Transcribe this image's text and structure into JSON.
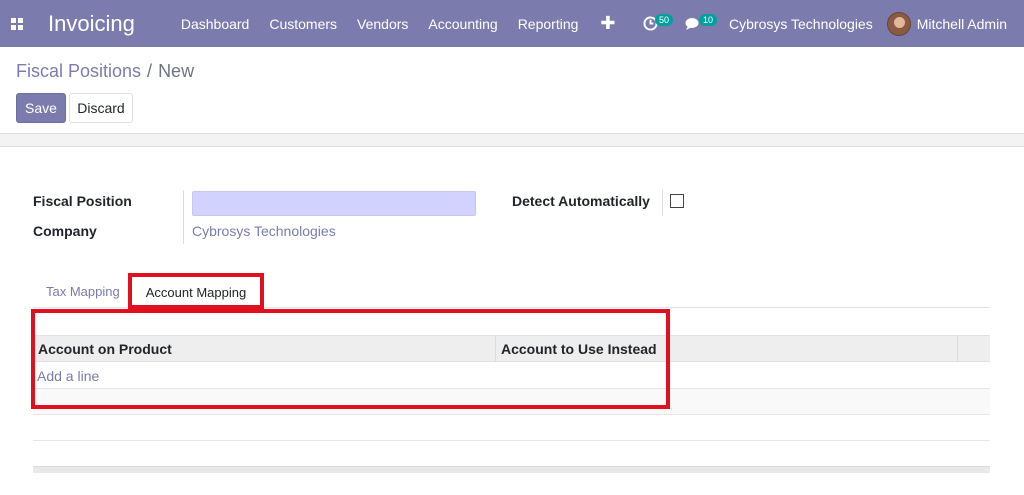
{
  "navbar": {
    "app_name": "Invoicing",
    "menu": [
      "Dashboard",
      "Customers",
      "Vendors",
      "Accounting",
      "Reporting"
    ],
    "activity_count": "50",
    "message_count": "10",
    "company": "Cybrosys Technologies",
    "user": "Mitchell Admin",
    "accent_color": "#7c7bad"
  },
  "breadcrumb": {
    "parent": "Fiscal Positions",
    "separator": "/",
    "current": "New"
  },
  "buttons": {
    "save": "Save",
    "discard": "Discard"
  },
  "form": {
    "fiscal_position_label": "Fiscal Position",
    "fiscal_position_value": "",
    "company_label": "Company",
    "company_value": "Cybrosys Technologies",
    "detect_label": "Detect Automatically",
    "detect_checked": false
  },
  "tabs": [
    {
      "label": "Tax Mapping",
      "active": false
    },
    {
      "label": "Account Mapping",
      "active": true
    }
  ],
  "table": {
    "columns": [
      "Account on Product",
      "Account to Use Instead"
    ],
    "add_line": "Add a line"
  },
  "highlight_color": "#e0101e"
}
